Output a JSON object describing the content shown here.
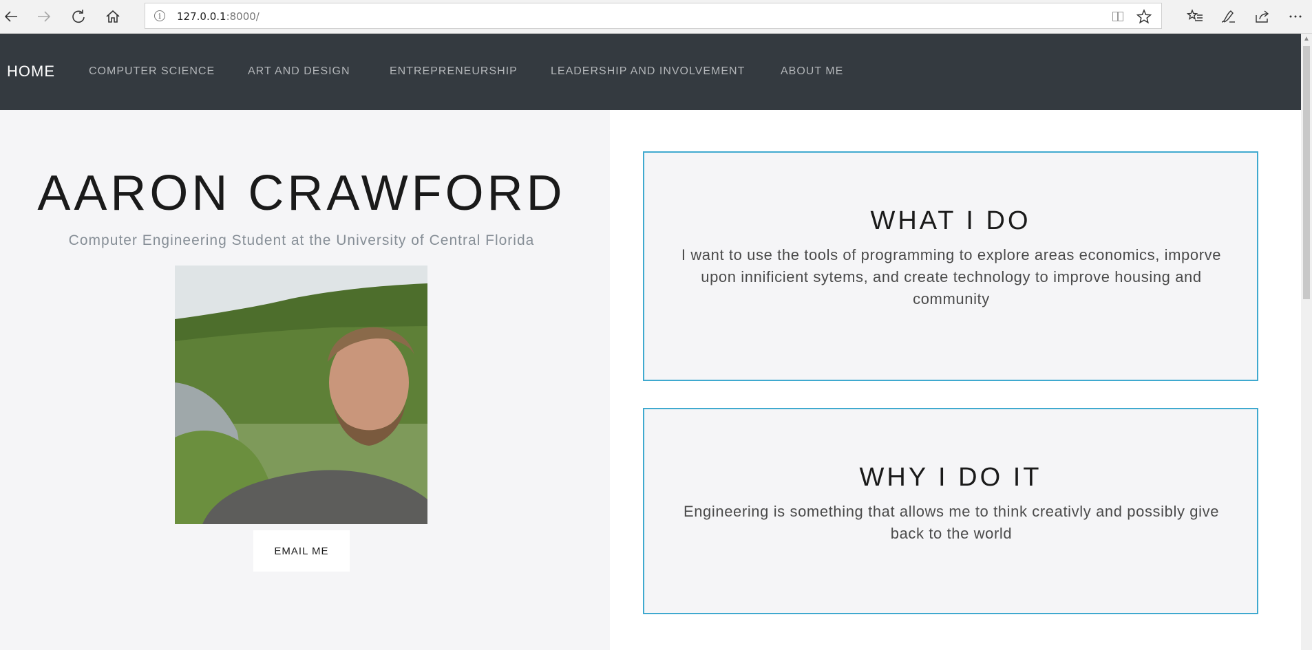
{
  "browser": {
    "url_host": "127.0.0.1",
    "url_port": ":8000/",
    "icons": {
      "back": "arrow-left-icon",
      "forward": "arrow-right-icon",
      "refresh": "refresh-icon",
      "home": "home-icon",
      "site_info": "info-icon",
      "reading_view": "reading-view-icon",
      "favorite": "star-icon",
      "favorites_list": "favorites-list-icon",
      "notes": "pen-icon",
      "share": "share-icon",
      "more": "ellipsis-icon"
    }
  },
  "navbar": {
    "brand": "HOME",
    "links": [
      "COMPUTER SCIENCE",
      "ART AND DESIGN",
      "ENTREPRENEURSHIP",
      "LEADERSHIP AND INVOLVEMENT",
      "ABOUT ME"
    ]
  },
  "hero": {
    "name": "AARON CRAWFORD",
    "subtitle": "Computer Engineering Student at the University of Central Florida",
    "email_button": "EMAIL ME"
  },
  "cards": [
    {
      "title": "WHAT I DO",
      "body": "I want to use the tools of programming to explore areas economics, imporve upon innificient sytems, and create technology to improve housing and community"
    },
    {
      "title": "WHY I DO IT",
      "body": "Engineering is something that allows me to think creativly and possibly give back to the world"
    }
  ],
  "colors": {
    "navbar_bg": "#343a40",
    "card_border": "#3fa9cf",
    "left_bg": "#f5f5f7"
  }
}
